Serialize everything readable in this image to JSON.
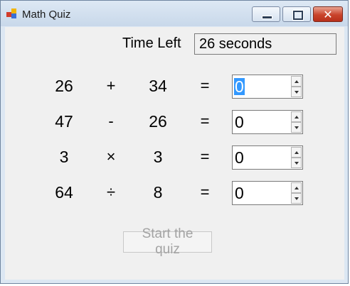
{
  "window": {
    "title": "Math Quiz"
  },
  "timer": {
    "label": "Time Left",
    "value": "26 seconds"
  },
  "problems": [
    {
      "left": "26",
      "operator": "+",
      "right": "34",
      "equals": "=",
      "answer": "0"
    },
    {
      "left": "47",
      "operator": "-",
      "right": "26",
      "equals": "=",
      "answer": "0"
    },
    {
      "left": "3",
      "operator": "×",
      "right": "3",
      "equals": "=",
      "answer": "0"
    },
    {
      "left": "64",
      "operator": "÷",
      "right": "8",
      "equals": "=",
      "answer": "0"
    }
  ],
  "buttons": {
    "start_label": "Start the quiz",
    "close_glyph": "✕"
  },
  "colors": {
    "selection": "#3399ff",
    "close_button": "#c9432b",
    "disabled_text": "#a3a3a3"
  }
}
